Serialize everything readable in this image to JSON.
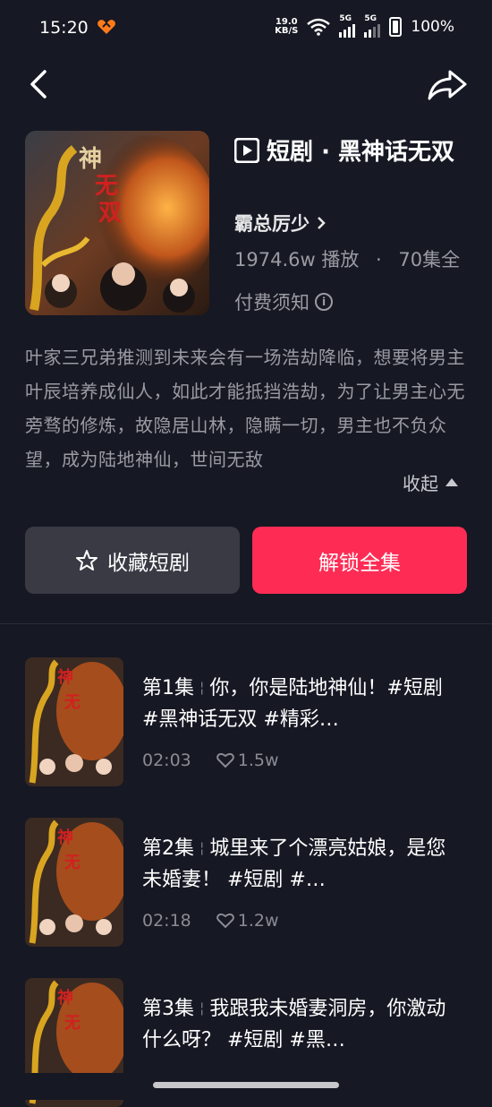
{
  "status_bar": {
    "time": "15:20",
    "net_speed_value": "19.0",
    "net_speed_unit": "KB/S",
    "signal1": "5G",
    "signal2": "5G",
    "battery": "100%"
  },
  "drama": {
    "category": "短剧",
    "dot": "·",
    "title": "黑神话无双",
    "author": "霸总厉少",
    "plays": "1974.6w 播放",
    "episodes_total": "70集全",
    "fee_notice": "付费须知",
    "description": "叶家三兄弟推测到未来会有一场浩劫降临，想要将男主叶辰培养成仙人，如此才能抵挡浩劫，为了让男主心无旁骛的修炼，故隐居山林，隐瞒一切，男主也不负众望，成为陆地神仙，世间无敌",
    "collapse_label": "收起"
  },
  "actions": {
    "favorite_label": "收藏短剧",
    "unlock_label": "解锁全集"
  },
  "episodes": [
    {
      "ep": "第1集",
      "text": "你，你是陆地神仙！#短剧 #黑神话无双 #精彩…",
      "duration": "02:03",
      "likes": "1.5w"
    },
    {
      "ep": "第2集",
      "text": "城里来了个漂亮姑娘，是您未婚妻！ #短剧 #…",
      "duration": "02:18",
      "likes": "1.2w"
    },
    {
      "ep": "第3集",
      "text": "我跟我未婚妻洞房，你激动什么呀？ #短剧 #黑…",
      "duration": "",
      "likes": ""
    }
  ],
  "colors": {
    "background": "#161823",
    "accent": "#fe2c55",
    "secondary_button": "#393a44",
    "muted_text": "#9a9ba3"
  }
}
